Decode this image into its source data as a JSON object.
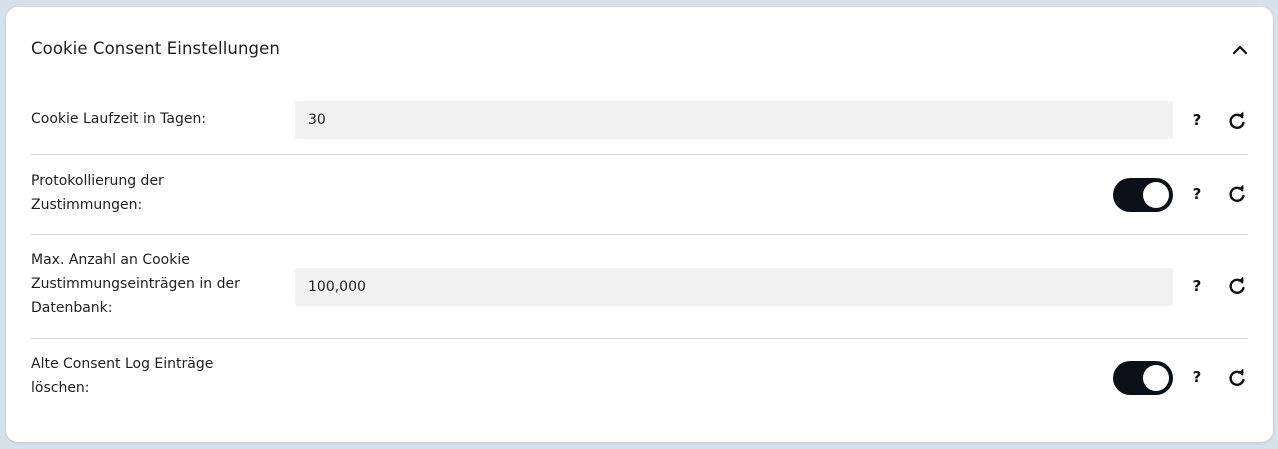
{
  "panel": {
    "title": "Cookie Consent Einstellungen",
    "collapse_icon": "chevron-up-icon"
  },
  "settings": [
    {
      "label": "Cookie Laufzeit in Tagen:",
      "type": "input",
      "value": "30",
      "help": "?",
      "reset_icon": "reset-icon"
    },
    {
      "label": "Protokollierung der Zustimmungen:",
      "type": "toggle",
      "value": true,
      "help": "?",
      "reset_icon": "reset-icon"
    },
    {
      "label": "Max. Anzahl an Cookie Zustimmungseinträgen in der Datenbank:",
      "type": "input",
      "value": "100,000",
      "help": "?",
      "reset_icon": "reset-icon"
    },
    {
      "label": "Alte Consent Log Einträge löschen:",
      "type": "toggle",
      "value": true,
      "help": "?",
      "reset_icon": "reset-icon"
    }
  ],
  "colors": {
    "toggle_on": "#0c1118",
    "input_bg": "#f1f1f1",
    "page_bg": "#d7e1e8"
  }
}
